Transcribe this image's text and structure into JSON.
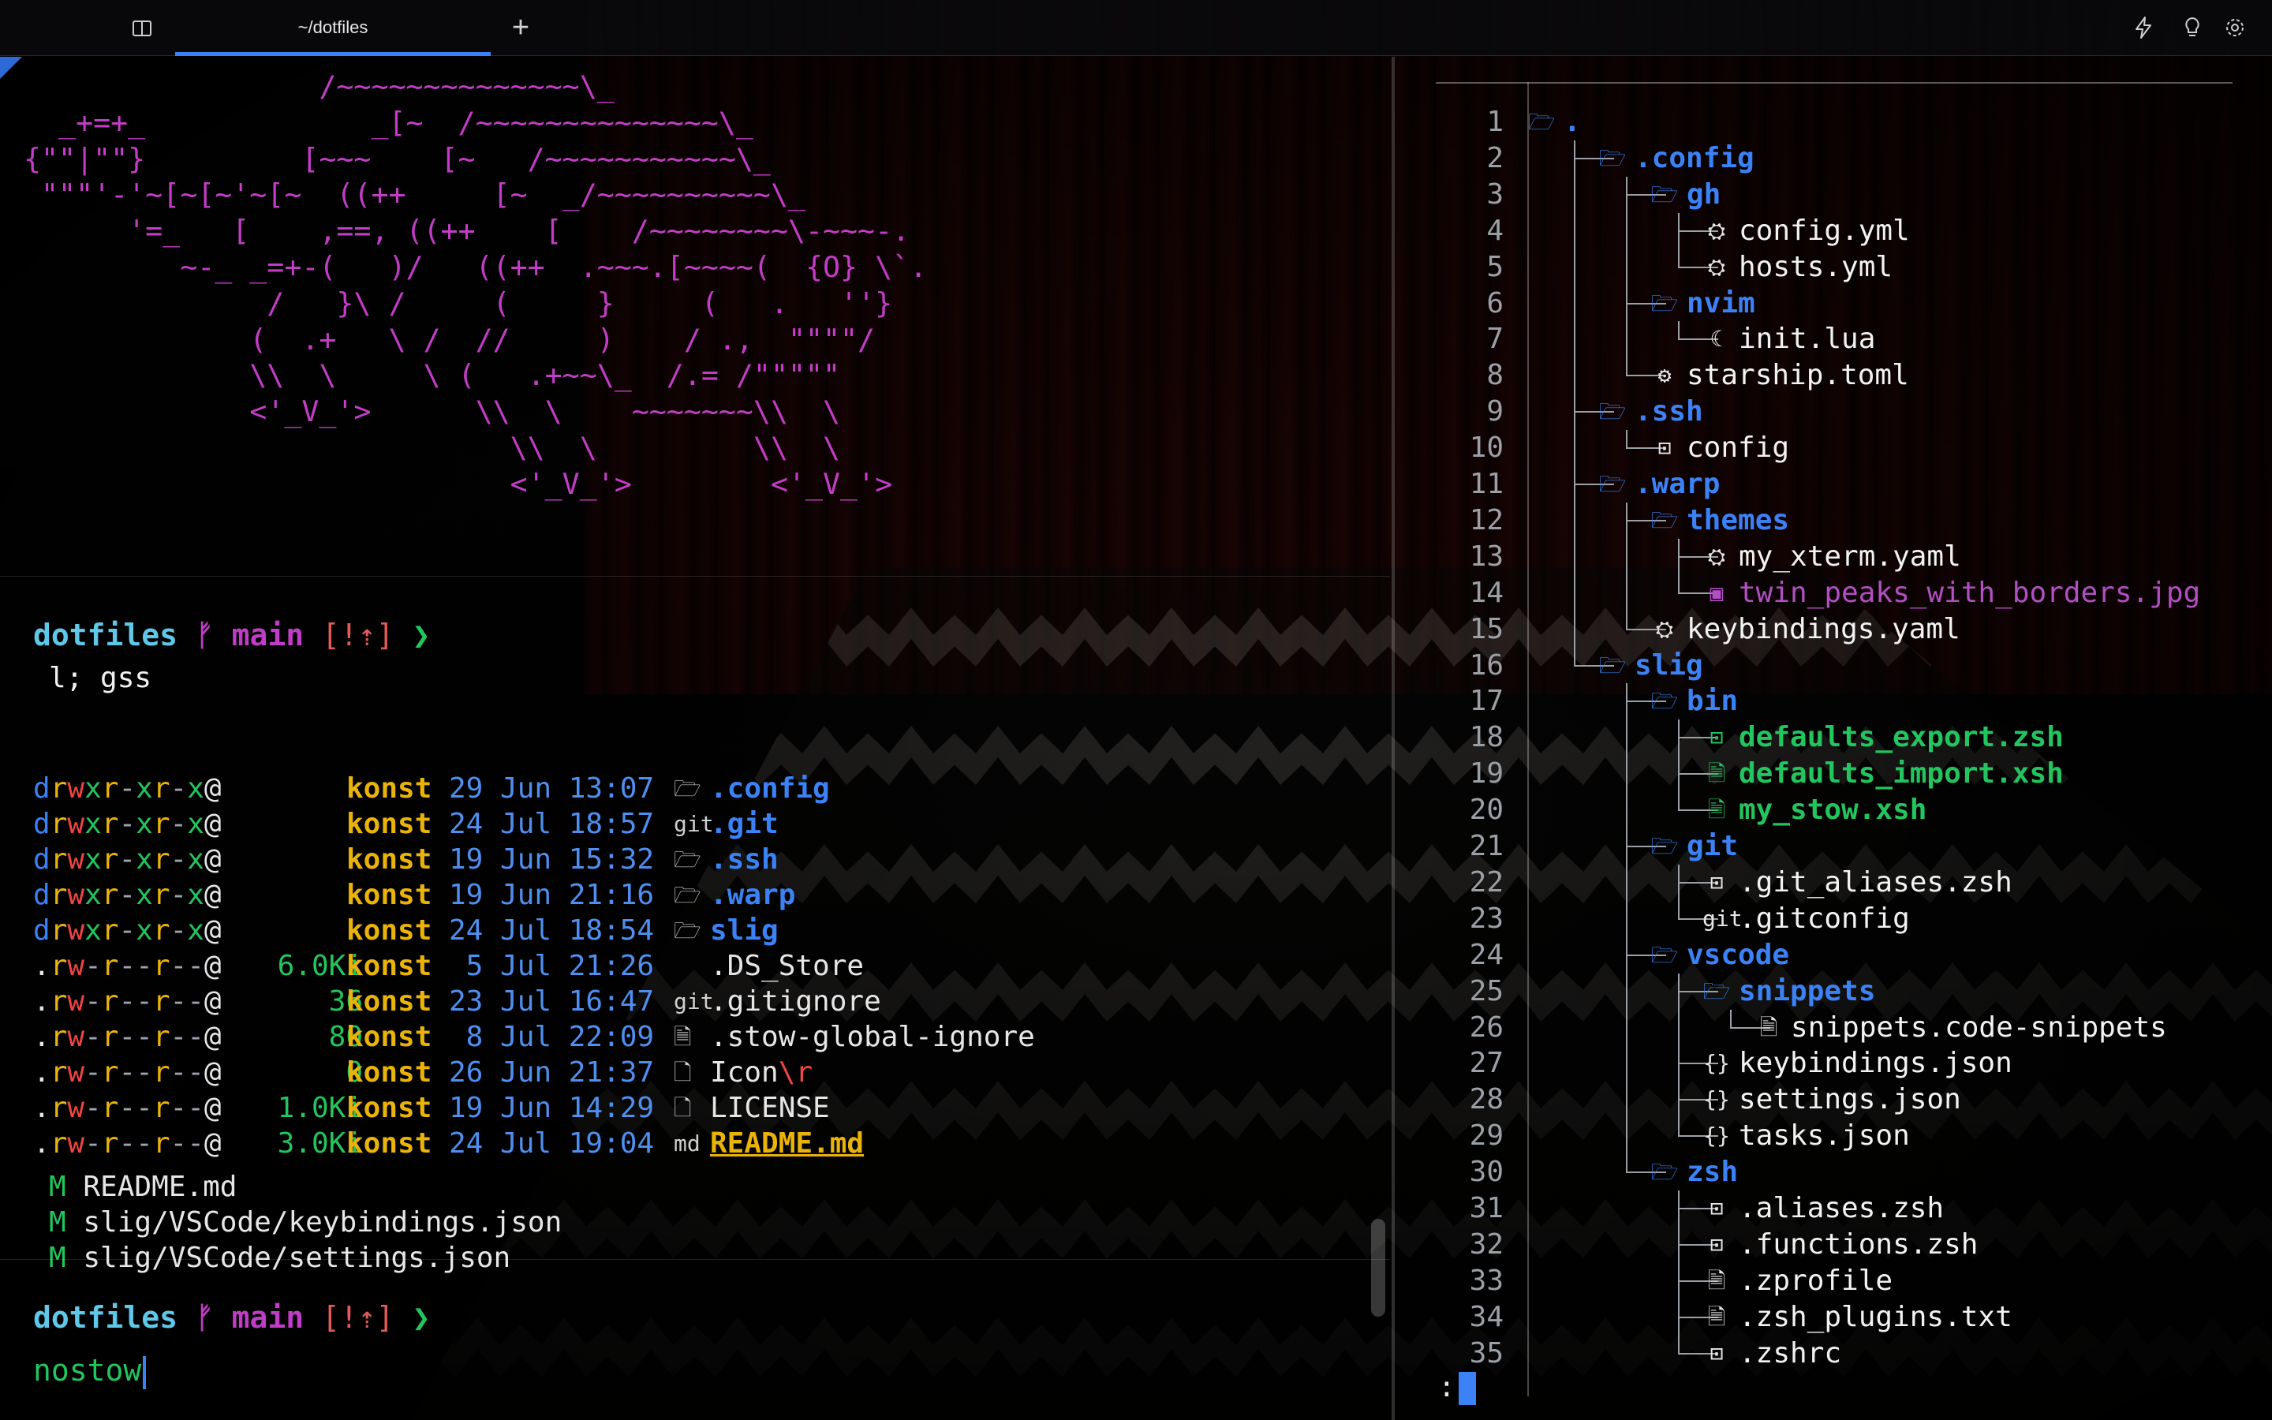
{
  "tab_bar": {
    "active_tab_title": "~/dotfiles",
    "new_tab_label": "+",
    "icons": [
      "panel-icon",
      "lightning-icon",
      "lightbulb-icon",
      "settings-gear-icon"
    ]
  },
  "colors": {
    "accent_blue": "#3b82f6",
    "prompt_dir": "#5fc7e8",
    "branch_magenta": "#c13cc7",
    "git_status_red": "#e05b5b",
    "prompt_arrow_green": "#22c55e",
    "ascii_magenta": "#c43cc8"
  },
  "left_pane": {
    "ascii_art": [
      "                 /~~~~~~~~~~~~~~\\_",
      "  _+=+_             _[~  /~~~~~~~~~~~~~~\\_",
      "{\"\"|\"\"}         [~~~    [~   /~~~~~~~~~~~\\_",
      " \"\"\"'-'~[~[~'~[~  ((++     [~  _/~~~~~~~~~~\\_",
      "      '=_   [    ,==, ((++    [    /~~~~~~~~\\-~~~-.",
      "         ~-_ _=+-(   )/   ((++  .~~~.[~~~~(  {O} \\`.",
      "              /   }\\ /     (     }     (   .   ''}",
      "             (  .+   \\ /  //     )    / .,  \"\"\"\"/",
      "             \\\\  \\     \\ (   .+~~\\_  /.= /\"\"\"\"\"",
      "             <'_V_'>      \\\\  \\    ~~~~~~~\\\\  \\",
      "                            \\\\  \\         \\\\  \\",
      "                            <'_V_'>        <'_V_'>"
    ],
    "prompt": {
      "dir": "dotfiles",
      "branch_symbol": "ᚠ",
      "branch": "main",
      "git_status": "[!⇡]",
      "arrow": "❯"
    },
    "command": "l; gss",
    "ls_rows": [
      {
        "perm": "drwxr-xr-x@",
        "size": "-",
        "user": "konst",
        "date": "29 Jun 13:07",
        "icon": "🗁",
        "name": ".config",
        "kind": "dir"
      },
      {
        "perm": "drwxr-xr-x@",
        "size": "-",
        "user": "konst",
        "date": "24 Jul 18:57",
        "icon": "git",
        "name": ".git",
        "kind": "dir"
      },
      {
        "perm": "drwxr-xr-x@",
        "size": "-",
        "user": "konst",
        "date": "19 Jun 15:32",
        "icon": "🗁",
        "name": ".ssh",
        "kind": "dir"
      },
      {
        "perm": "drwxr-xr-x@",
        "size": "-",
        "user": "konst",
        "date": "19 Jun 21:16",
        "icon": "🗁",
        "name": ".warp",
        "kind": "dir"
      },
      {
        "perm": "drwxr-xr-x@",
        "size": "-",
        "user": "konst",
        "date": "24 Jul 18:54",
        "icon": "🗁",
        "name": "slig",
        "kind": "dir"
      },
      {
        "perm": ".rw-r--r--@",
        "size": "6.0Ki",
        "user": "konst",
        "date": " 5 Jul 21:26",
        "icon": "",
        "name": ".DS_Store",
        "kind": "file"
      },
      {
        "perm": ".rw-r--r--@",
        "size": "36",
        "user": "konst",
        "date": "23 Jul 16:47",
        "icon": "git",
        "name": ".gitignore",
        "kind": "file"
      },
      {
        "perm": ".rw-r--r--@",
        "size": "80",
        "user": "konst",
        "date": " 8 Jul 22:09",
        "icon": "🗎",
        "name": ".stow-global-ignore",
        "kind": "file"
      },
      {
        "perm": ".rw-r--r--@",
        "size": "0",
        "user": "konst",
        "date": "26 Jun 21:37",
        "icon": "🗋",
        "name": "Icon",
        "suffix": "\\r",
        "kind": "file"
      },
      {
        "perm": ".rw-r--r--@",
        "size": "1.0Ki",
        "user": "konst",
        "date": "19 Jun 14:29",
        "icon": "🗋",
        "name": "LICENSE",
        "kind": "file"
      },
      {
        "perm": ".rw-r--r--@",
        "size": "3.0Ki",
        "user": "konst",
        "date": "24 Jul 19:04",
        "icon": "md",
        "name": "README.md",
        "kind": "readme"
      }
    ],
    "git_status": [
      {
        "flag": "M",
        "file": "README.md"
      },
      {
        "flag": "M",
        "file": "slig/VSCode/keybindings.json"
      },
      {
        "flag": "M",
        "file": "slig/VSCode/settings.json"
      }
    ],
    "prompt2": {
      "dir": "dotfiles",
      "branch_symbol": "ᚠ",
      "branch": "main",
      "git_status": "[!⇡]",
      "arrow": "❯"
    },
    "input_value": "nostow"
  },
  "right_pane": {
    "pager_prompt": ":",
    "tree": [
      {
        "n": "1",
        "d": 0,
        "last": false,
        "icon": "🗁",
        "name": ".",
        "kind": "dir"
      },
      {
        "n": "2",
        "d": 1,
        "last": false,
        "icon": "🗁",
        "name": ".config",
        "kind": "dir"
      },
      {
        "n": "3",
        "d": 2,
        "last": false,
        "icon": "🗁",
        "name": "gh",
        "kind": "dir"
      },
      {
        "n": "4",
        "d": 3,
        "last": false,
        "icon": "⛭",
        "name": "config.yml",
        "kind": "file"
      },
      {
        "n": "5",
        "d": 3,
        "last": true,
        "icon": "⛭",
        "name": "hosts.yml",
        "kind": "file"
      },
      {
        "n": "6",
        "d": 2,
        "last": false,
        "icon": "🗁",
        "name": "nvim",
        "kind": "dir"
      },
      {
        "n": "7",
        "d": 3,
        "last": true,
        "icon": "☾",
        "name": "init.lua",
        "kind": "file"
      },
      {
        "n": "8",
        "d": 2,
        "last": true,
        "icon": "⚙",
        "name": "starship.toml",
        "kind": "file"
      },
      {
        "n": "9",
        "d": 1,
        "last": false,
        "icon": "🗁",
        "name": ".ssh",
        "kind": "dir"
      },
      {
        "n": "10",
        "d": 2,
        "last": true,
        "icon": "⊡",
        "name": "config",
        "kind": "file"
      },
      {
        "n": "11",
        "d": 1,
        "last": false,
        "icon": "🗁",
        "name": ".warp",
        "kind": "dir"
      },
      {
        "n": "12",
        "d": 2,
        "last": false,
        "icon": "🗁",
        "name": "themes",
        "kind": "dir"
      },
      {
        "n": "13",
        "d": 3,
        "last": false,
        "icon": "⛭",
        "name": "my_xterm.yaml",
        "kind": "file"
      },
      {
        "n": "14",
        "d": 3,
        "last": true,
        "icon": "▣",
        "name": "twin_peaks_with_borders.jpg",
        "kind": "image"
      },
      {
        "n": "15",
        "d": 2,
        "last": true,
        "icon": "⛭",
        "name": "keybindings.yaml",
        "kind": "file"
      },
      {
        "n": "16",
        "d": 1,
        "last": true,
        "icon": "🗁",
        "name": "slig",
        "kind": "dir"
      },
      {
        "n": "17",
        "d": 2,
        "last": false,
        "icon": "🗁",
        "name": "bin",
        "kind": "dir"
      },
      {
        "n": "18",
        "d": 3,
        "last": false,
        "icon": "⊡",
        "name": "defaults_export.zsh",
        "kind": "exec"
      },
      {
        "n": "19",
        "d": 3,
        "last": false,
        "icon": "🗎",
        "name": "defaults_import.xsh",
        "kind": "exec"
      },
      {
        "n": "20",
        "d": 3,
        "last": true,
        "icon": "🗎",
        "name": "my_stow.xsh",
        "kind": "exec"
      },
      {
        "n": "21",
        "d": 2,
        "last": false,
        "icon": "🗁",
        "name": "git",
        "kind": "dir"
      },
      {
        "n": "22",
        "d": 3,
        "last": false,
        "icon": "⊡",
        "name": ".git_aliases.zsh",
        "kind": "file"
      },
      {
        "n": "23",
        "d": 3,
        "last": true,
        "icon": "git",
        "name": ".gitconfig",
        "kind": "file"
      },
      {
        "n": "24",
        "d": 2,
        "last": false,
        "icon": "🗁",
        "name": "vscode",
        "kind": "dir"
      },
      {
        "n": "25",
        "d": 3,
        "last": false,
        "icon": "🗁",
        "name": "snippets",
        "kind": "dir"
      },
      {
        "n": "26",
        "d": 4,
        "last": true,
        "icon": "🗎",
        "name": "snippets.code-snippets",
        "kind": "file"
      },
      {
        "n": "27",
        "d": 3,
        "last": false,
        "icon": "{}",
        "name": "keybindings.json",
        "kind": "file"
      },
      {
        "n": "28",
        "d": 3,
        "last": false,
        "icon": "{}",
        "name": "settings.json",
        "kind": "file"
      },
      {
        "n": "29",
        "d": 3,
        "last": true,
        "icon": "{}",
        "name": "tasks.json",
        "kind": "file"
      },
      {
        "n": "30",
        "d": 2,
        "last": true,
        "icon": "🗁",
        "name": "zsh",
        "kind": "dir"
      },
      {
        "n": "31",
        "d": 3,
        "last": false,
        "icon": "⊡",
        "name": ".aliases.zsh",
        "kind": "file"
      },
      {
        "n": "32",
        "d": 3,
        "last": false,
        "icon": "⊡",
        "name": ".functions.zsh",
        "kind": "file"
      },
      {
        "n": "33",
        "d": 3,
        "last": false,
        "icon": "🗎",
        "name": ".zprofile",
        "kind": "file"
      },
      {
        "n": "34",
        "d": 3,
        "last": false,
        "icon": "🗎",
        "name": ".zsh_plugins.txt",
        "kind": "file"
      },
      {
        "n": "35",
        "d": 3,
        "last": true,
        "icon": "⊡",
        "name": ".zshrc",
        "kind": "file"
      }
    ]
  }
}
